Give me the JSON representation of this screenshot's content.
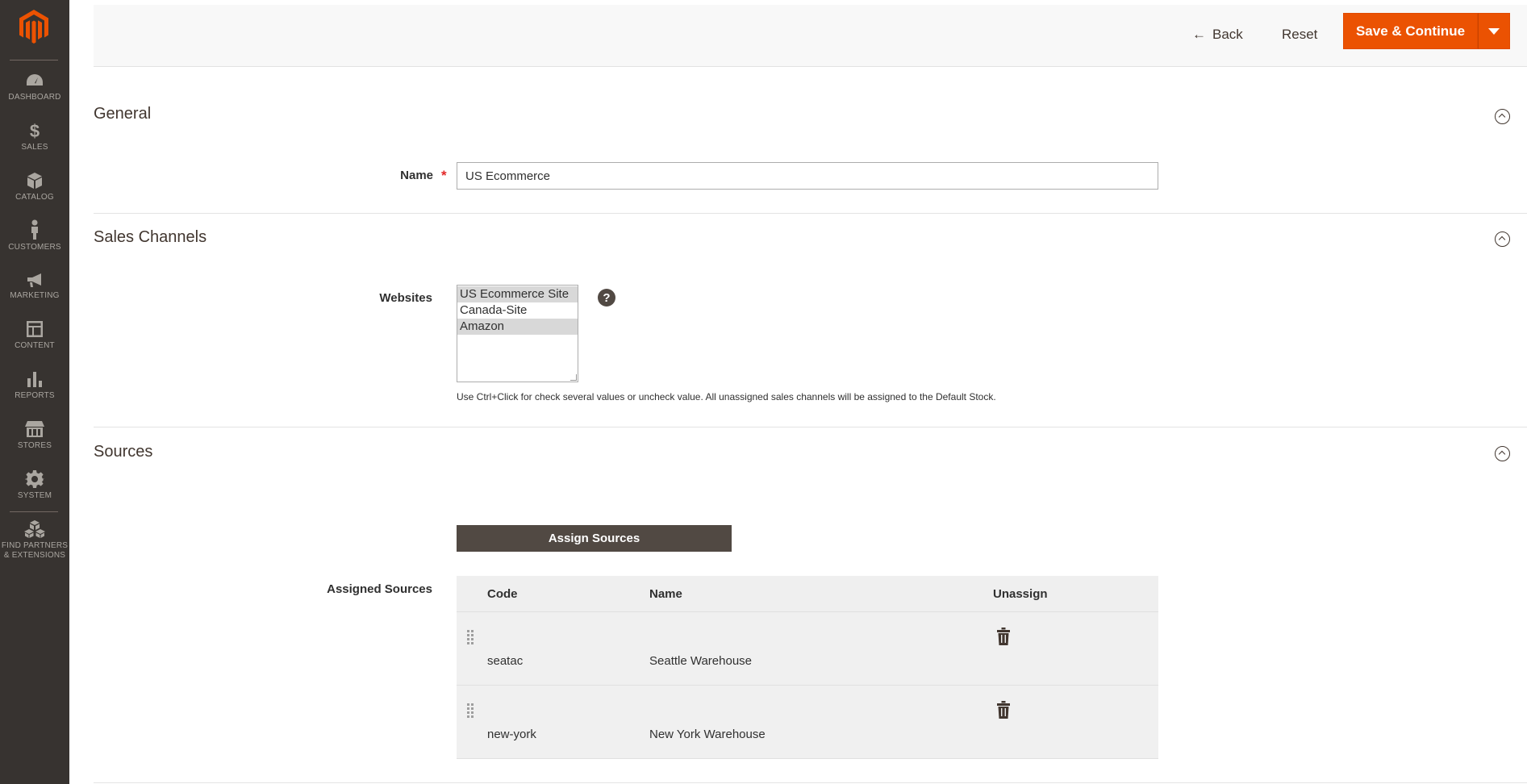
{
  "sidebar": {
    "logo": "magento-logo",
    "items": [
      {
        "label": "DASHBOARD",
        "icon": "dashboard-icon"
      },
      {
        "label": "SALES",
        "icon": "dollar-icon"
      },
      {
        "label": "CATALOG",
        "icon": "box-icon"
      },
      {
        "label": "CUSTOMERS",
        "icon": "person-icon"
      },
      {
        "label": "MARKETING",
        "icon": "megaphone-icon"
      },
      {
        "label": "CONTENT",
        "icon": "layout-icon"
      },
      {
        "label": "REPORTS",
        "icon": "bar-chart-icon"
      },
      {
        "label": "STORES",
        "icon": "store-icon"
      },
      {
        "label": "SYSTEM",
        "icon": "gear-icon"
      },
      {
        "label_line1": "FIND PARTNERS",
        "label_line2": "& EXTENSIONS",
        "icon": "cubes-icon"
      }
    ]
  },
  "actions": {
    "back_label": "Back",
    "reset_label": "Reset",
    "save_label": "Save & Continue"
  },
  "general": {
    "title": "General",
    "name_label": "Name",
    "name_value": "US Ecommerce"
  },
  "sales_channels": {
    "title": "Sales Channels",
    "websites_label": "Websites",
    "websites": [
      {
        "label": "US Ecommerce Site",
        "selected": true
      },
      {
        "label": "Canada-Site",
        "selected": false
      },
      {
        "label": "Amazon",
        "selected": true
      }
    ],
    "help_glyph": "?",
    "note": "Use Ctrl+Click for check several values or uncheck value. All unassigned sales channels will be assigned to the Default Stock."
  },
  "sources": {
    "title": "Sources",
    "assign_button": "Assign Sources",
    "assigned_label": "Assigned Sources",
    "columns": {
      "code": "Code",
      "name": "Name",
      "unassign": "Unassign"
    },
    "rows": [
      {
        "code": "seatac",
        "name": "Seattle Warehouse"
      },
      {
        "code": "new-york",
        "name": "New York Warehouse"
      }
    ]
  },
  "colors": {
    "sidebar_bg": "#373330",
    "primary_button": "#eb5202",
    "secondary_button": "#514943"
  }
}
